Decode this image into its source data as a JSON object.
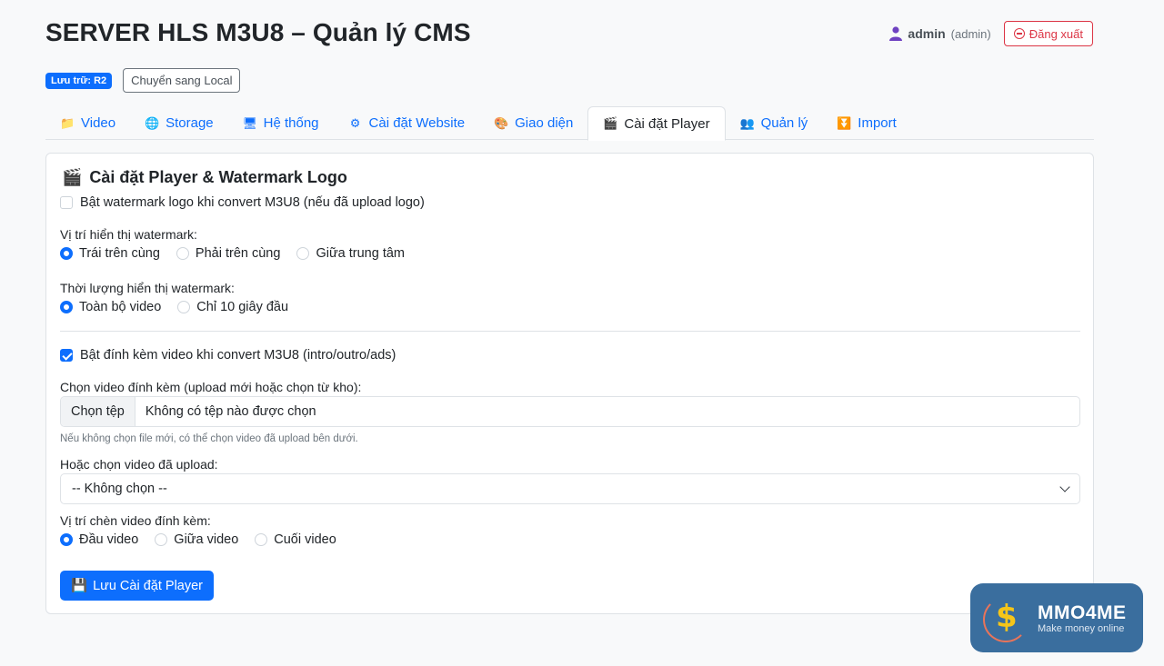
{
  "header": {
    "title": "SERVER HLS M3U8 – Quản lý CMS",
    "user_name": "admin",
    "user_role": "(admin)",
    "logout_label": "Đăng xuất"
  },
  "storage": {
    "badge": "Lưu trữ: R2",
    "switch_label": "Chuyển sang Local"
  },
  "tabs": [
    {
      "label": "Video",
      "icon": "📁"
    },
    {
      "label": "Storage",
      "icon": "🌐"
    },
    {
      "label": "Hệ thống",
      "icon": "🖥"
    },
    {
      "label": "Cài đặt Website",
      "icon": "⚙"
    },
    {
      "label": "Giao diện",
      "icon": "🎨"
    },
    {
      "label": "Cài đặt Player",
      "icon": "🎬",
      "active": true
    },
    {
      "label": "Quản lý",
      "icon": "👥"
    },
    {
      "label": "Import",
      "icon": "⏬"
    }
  ],
  "card": {
    "title_icon": "🎬",
    "title": "Cài đặt Player & Watermark Logo",
    "watermark_enable_label": "Bật watermark logo khi convert M3U8 (nếu đã upload logo)",
    "watermark_enabled": false,
    "position_label": "Vị trí hiển thị watermark:",
    "position_options": [
      "Trái trên cùng",
      "Phải trên cùng",
      "Giữa trung tâm"
    ],
    "position_selected": "Trái trên cùng",
    "duration_label": "Thời lượng hiển thị watermark:",
    "duration_options": [
      "Toàn bộ video",
      "Chỉ 10 giây đầu"
    ],
    "duration_selected": "Toàn bộ video",
    "attach_enable_label": "Bật đính kèm video khi convert M3U8 (intro/outro/ads)",
    "attach_enabled": true,
    "choose_video_label": "Chọn video đính kèm (upload mới hoặc chọn từ kho):",
    "file_button": "Chọn tệp",
    "file_text": "Không có tệp nào được chọn",
    "file_help": "Nếu không chọn file mới, có thể chọn video đã upload bên dưới.",
    "uploaded_label": "Hoặc chọn video đã upload:",
    "uploaded_selected": "-- Không chọn --",
    "insert_position_label": "Vị trí chèn video đính kèm:",
    "insert_options": [
      "Đầu video",
      "Giữa video",
      "Cuối video"
    ],
    "insert_selected": "Đầu video",
    "save_icon": "💾",
    "save_label": "Lưu Cài đặt Player"
  },
  "watermark_logo": {
    "main": "MMO4ME",
    "sub": "Make money online"
  },
  "colors": {
    "primary": "#0d6efd",
    "danger": "#dc3545",
    "logo_bg": "#3a6e9e"
  }
}
